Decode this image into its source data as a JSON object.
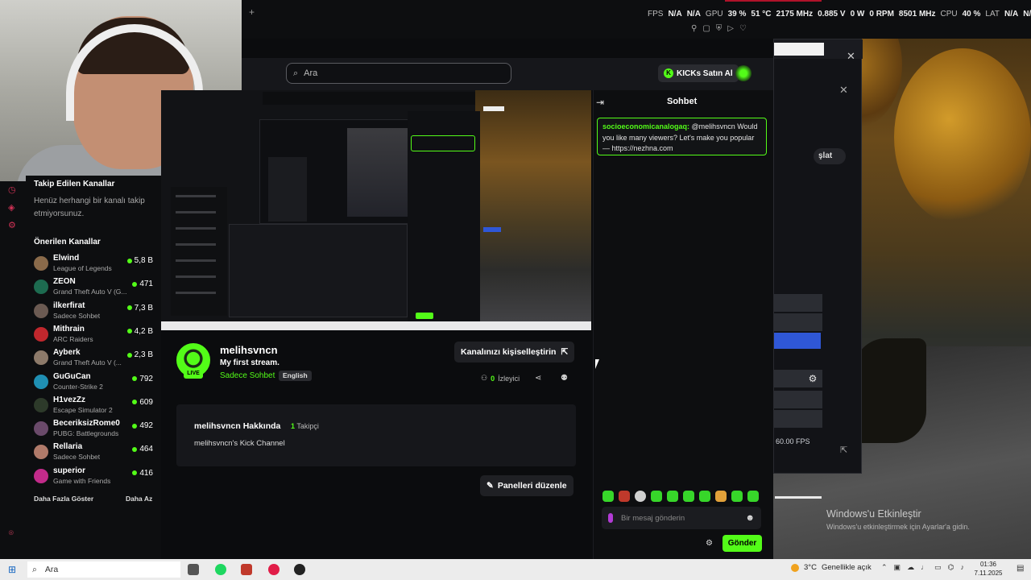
{
  "overlay": {
    "fps_label": "FPS",
    "fps_value": "N/A",
    "fps_value2": "N/A",
    "gpu_label": "GPU",
    "gpu_usage": "39 %",
    "gpu_temp": "51 °C",
    "gpu_clock": "2175 MHz",
    "gpu_volt": "0.885 V",
    "gpu_power": "0 W",
    "gpu_rpm": "0 RPM",
    "mem_clock": "8501 MHz",
    "cpu_label": "CPU",
    "cpu_usage": "40 %",
    "lat_label": "LAT",
    "lat_value": "N/A",
    "lat_value2": "N/A"
  },
  "browser": {
    "new_tab": "+"
  },
  "header": {
    "search_placeholder": "Ara",
    "kicks_label": "KICKs Satın Al",
    "kicks_glyph": "K"
  },
  "sidebar": {
    "followed_title": "Takip Edilen Kanallar",
    "followed_empty": "Henüz herhangi bir kanalı takip etmiyorsunuz.",
    "recommended_title": "Önerilen Kanallar",
    "show_more": "Daha Fazla Göster",
    "show_less": "Daha Az",
    "channels": [
      {
        "name": "Elwind",
        "category": "League of Legends",
        "viewers": "5,8 B",
        "color": "#8a6a4a"
      },
      {
        "name": "ZEON",
        "category": "Grand Theft Auto V (G...",
        "viewers": "471",
        "color": "#1d6b50"
      },
      {
        "name": "ilkerfirat",
        "category": "Sadece Sohbet",
        "viewers": "7,3 B",
        "color": "#6b5a52"
      },
      {
        "name": "Mithrain",
        "category": "ARC Raiders",
        "viewers": "4,2 B",
        "color": "#c0272d"
      },
      {
        "name": "Ayberk",
        "category": "Grand Theft Auto V (...",
        "viewers": "2,3 B",
        "color": "#8d7a6a"
      },
      {
        "name": "GuGuCan",
        "category": "Counter-Strike 2",
        "viewers": "792",
        "color": "#1f8fb3"
      },
      {
        "name": "H1vezZz",
        "category": "Escape Simulator 2",
        "viewers": "609",
        "color": "#2d3a2a"
      },
      {
        "name": "BeceriksizRome0",
        "category": "PUBG: Battlegrounds",
        "viewers": "492",
        "color": "#6a4a6a"
      },
      {
        "name": "Rellaria",
        "category": "Sadece Sohbet",
        "viewers": "464",
        "color": "#b07a6a"
      },
      {
        "name": "superior",
        "category": "Game with Friends",
        "viewers": "416",
        "color": "#c22b8a"
      }
    ]
  },
  "channel": {
    "name": "melihsvncn",
    "stream_title": "My first stream.",
    "category": "Sadece Sohbet",
    "language": "English",
    "live_badge": "LIVE",
    "customize_label": "Kanalınızı kişiselleştirin",
    "viewer_count": "0",
    "viewer_label": "İzleyici",
    "about_title": "melihsvncn Hakkında",
    "followers_count": "1",
    "followers_label": "Takipçi",
    "about_desc": "melihsvncn's Kick Channel",
    "edit_panels_label": "Panelleri düzenle"
  },
  "chat": {
    "title": "Sohbet",
    "message_user": "socioeconomicanalogaq:",
    "message_text": "@melihsvncn Would you like many viewers? Let's make you popular — https://nezhna.com",
    "input_placeholder": "Bir mesaj gönderin",
    "send_label": "Gönder"
  },
  "ghost_window": {
    "fps_text": "60.00 FPS",
    "pill_text": "şlat"
  },
  "watermark": {
    "title": "Windows'u Etkinleştir",
    "subtitle": "Windows'u etkinleştirmek için Ayarlar'a gidin."
  },
  "taskbar": {
    "search_placeholder": "Ara",
    "weather_temp": "3°C",
    "weather_desc": "Genellikle açık",
    "time": "01:36",
    "date": "7.11.2025"
  },
  "colors": {
    "kick_green": "#53fc18",
    "panel_bg": "#16171b",
    "page_bg": "#0b0c0e"
  }
}
